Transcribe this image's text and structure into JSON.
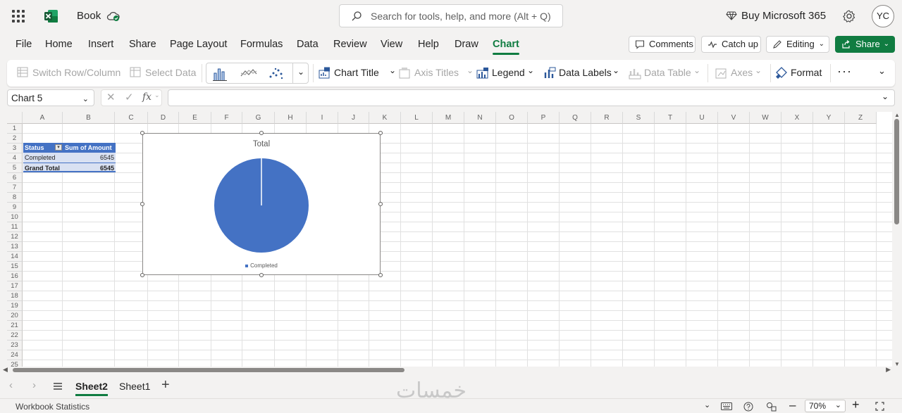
{
  "app": {
    "book_name": "Book",
    "search_placeholder": "Search for tools, help, and more (Alt + Q)",
    "buy_label": "Buy Microsoft 365",
    "avatar_initials": "YC"
  },
  "menu": {
    "tabs": [
      "File",
      "Home",
      "Insert",
      "Share",
      "Page Layout",
      "Formulas",
      "Data",
      "Review",
      "View",
      "Help",
      "Draw",
      "Chart"
    ],
    "active_tab": "Chart",
    "comments_label": "Comments",
    "catchup_label": "Catch up",
    "editing_label": "Editing",
    "share_label": "Share"
  },
  "ribbon": {
    "switch_row_col": "Switch Row/Column",
    "select_data": "Select Data",
    "chart_title": "Chart Title",
    "axis_titles": "Axis Titles",
    "legend": "Legend",
    "data_labels": "Data Labels",
    "data_table": "Data Table",
    "axes": "Axes",
    "format": "Format"
  },
  "formula_bar": {
    "name_box": "Chart 5",
    "fx": "fx",
    "value": ""
  },
  "grid": {
    "columns": [
      "A",
      "B",
      "C",
      "D",
      "E",
      "F",
      "G",
      "H",
      "I",
      "J",
      "K",
      "L",
      "M",
      "N",
      "O",
      "P",
      "Q",
      "R",
      "S",
      "T",
      "U",
      "V",
      "W",
      "X",
      "Y",
      "Z"
    ],
    "rows": [
      "1",
      "2",
      "3",
      "4",
      "5",
      "6",
      "7",
      "8",
      "9",
      "10",
      "11",
      "12",
      "13",
      "14",
      "15",
      "16",
      "17",
      "18",
      "19",
      "20",
      "21",
      "22",
      "23",
      "24",
      "25"
    ]
  },
  "pivot": {
    "header_status": "Status",
    "header_sum": "Sum of Amount",
    "row_label": "Completed",
    "row_value": "6545",
    "total_label": "Grand Total",
    "total_value": "6545"
  },
  "chart_data": {
    "type": "pie",
    "title": "Total",
    "categories": [
      "Completed"
    ],
    "values": [
      6545
    ],
    "legend": [
      "Completed"
    ],
    "legend_position": "bottom",
    "colors": [
      "#4472c4"
    ]
  },
  "sheets": {
    "tabs": [
      "Sheet2",
      "Sheet1"
    ],
    "active": "Sheet2"
  },
  "status": {
    "workbook_statistics": "Workbook Statistics",
    "zoom": "70%"
  },
  "colors": {
    "accent": "#107c41",
    "pivot_header": "#4472c4",
    "pivot_body": "#d9e1f2"
  },
  "watermark": "خمسات"
}
